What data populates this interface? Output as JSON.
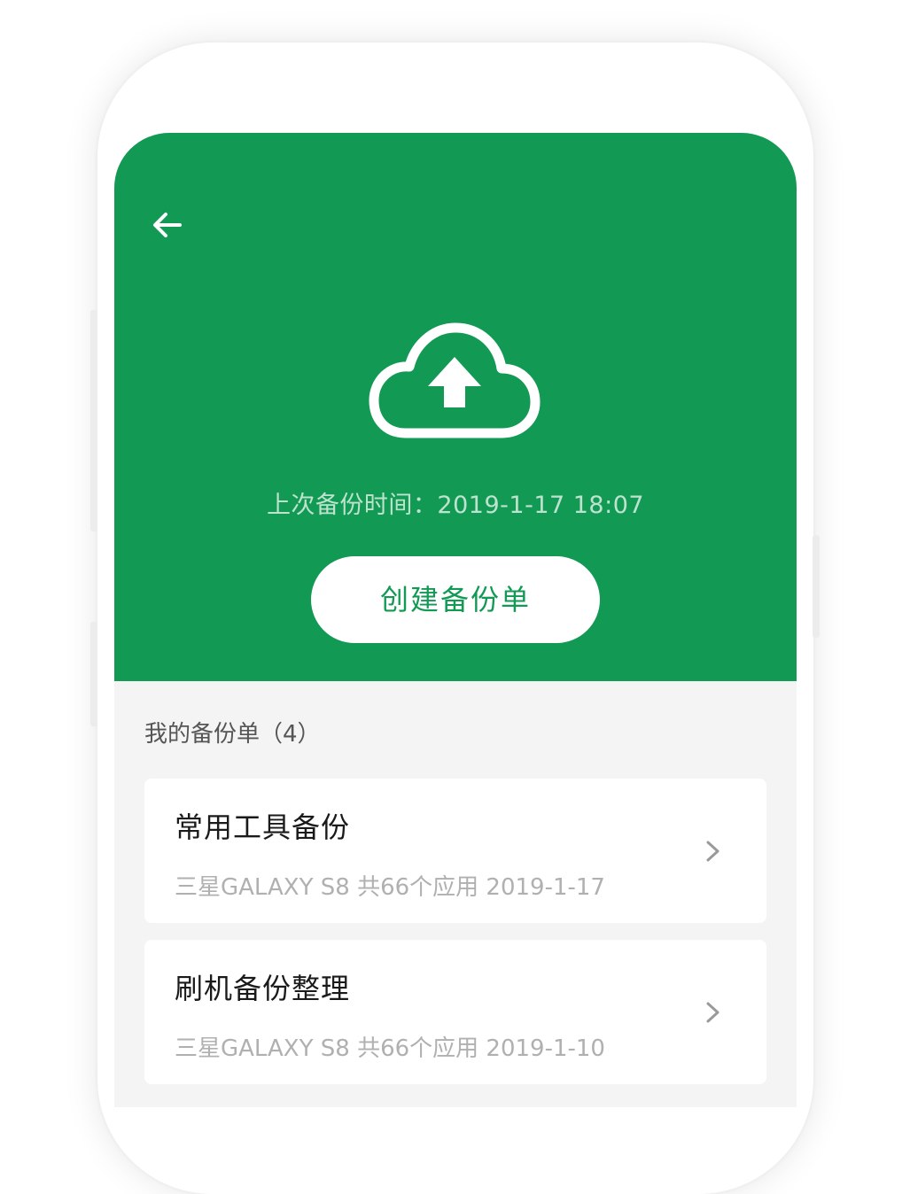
{
  "header": {
    "back_icon": "arrow-left-icon",
    "hero_icon": "cloud-upload-icon",
    "last_backup_text": "上次备份时间：2019-1-17 18:07",
    "create_button_label": "创建备份单"
  },
  "backups": {
    "section_title": "我的备份单（4）",
    "items": [
      {
        "title": "常用工具备份",
        "subtitle": "三星GALAXY S8 共66个应用 2019-1-17"
      },
      {
        "title": "刷机备份整理",
        "subtitle": "三星GALAXY S8 共66个应用 2019-1-10"
      }
    ]
  },
  "colors": {
    "brand_green": "#129a55",
    "background": "#f4f4f4",
    "card": "#ffffff",
    "title_text": "#1a1a1a",
    "subtitle_text": "#b0b0b0"
  }
}
